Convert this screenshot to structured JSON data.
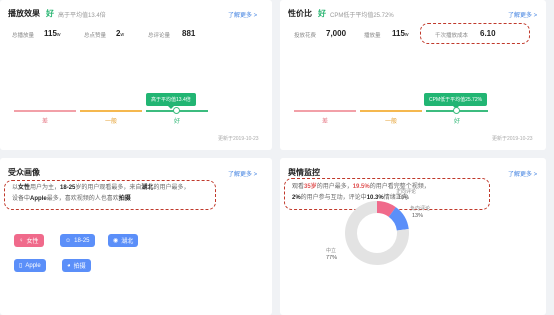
{
  "card1": {
    "title": "播放效果",
    "flag": "好",
    "sub": "高于平均值13.4倍",
    "learn_more": "了解更多 >",
    "stats": [
      {
        "label": "总播放量",
        "value": "115",
        "unit": "w"
      },
      {
        "label": "总点赞量",
        "value": "2",
        "unit": "w"
      },
      {
        "label": "总评论量",
        "value": "881",
        "unit": ""
      }
    ],
    "tooltip": "高于平均值13.4倍",
    "levels": [
      "差",
      "一般",
      "好"
    ],
    "updated": "更新于2019-10-23"
  },
  "card2": {
    "title": "性价比",
    "flag": "好",
    "sub": "CPM低于平均值25.72%",
    "learn_more": "了解更多 >",
    "stats": [
      {
        "label": "投放花费",
        "value": "7,000",
        "unit": ""
      },
      {
        "label": "播放量",
        "value": "115",
        "unit": "w"
      },
      {
        "label": "千次播放成本",
        "value": "6.10",
        "unit": ""
      }
    ],
    "tooltip": "CPM低于平均值25.72%",
    "levels": [
      "差",
      "一般",
      "好"
    ],
    "updated": "更新于2019-10-23"
  },
  "card3": {
    "title": "受众画像",
    "learn_more": "了解更多 >",
    "desc": {
      "p1": "以",
      "b1": "女性",
      "p2": "用户为主，",
      "b2": "18-25",
      "p3": "岁的用户观看最多，来自",
      "b3": "湖北",
      "p4": "的用户最多，",
      "p5": "设备中",
      "b4": "Apple",
      "p6": "最多，喜欢视频的人也喜欢",
      "b5": "拍摄"
    },
    "tags": [
      {
        "icon": "♀",
        "label": "女性"
      },
      {
        "icon": "☺",
        "label": "18-25"
      },
      {
        "icon": "◉",
        "label": "湖北"
      },
      {
        "icon": "▯",
        "label": "Apple"
      },
      {
        "icon": "◕",
        "label": "拍摄"
      }
    ],
    "colors": {
      "female": "#f06a8b",
      "blue": "#5b8ff9"
    }
  },
  "card4": {
    "title": "舆情监控",
    "learn_more": "了解更多 >",
    "desc": {
      "p1": "观看",
      "r1": "35岁",
      "p2": "的用户最多，",
      "r2": "19.5%",
      "p3": "的用户看完整个视频，",
      "b1": "2%",
      "p4": "的用户参与互动，评论中",
      "b2": "10.3%",
      "p5": "情绪正向"
    },
    "pie": {
      "positive_label": "正向评论",
      "positive_value": "10%",
      "negative_label": "负向评论",
      "negative_value": "13%",
      "neutral_label": "中立",
      "neutral_value": "77%"
    },
    "chart_data": {
      "type": "pie",
      "categories": [
        "正向评论",
        "负向评论",
        "中立"
      ],
      "values": [
        10,
        13,
        77
      ],
      "colors": [
        "#f06a8b",
        "#5b8ff9",
        "#e3e3e3"
      ]
    }
  }
}
